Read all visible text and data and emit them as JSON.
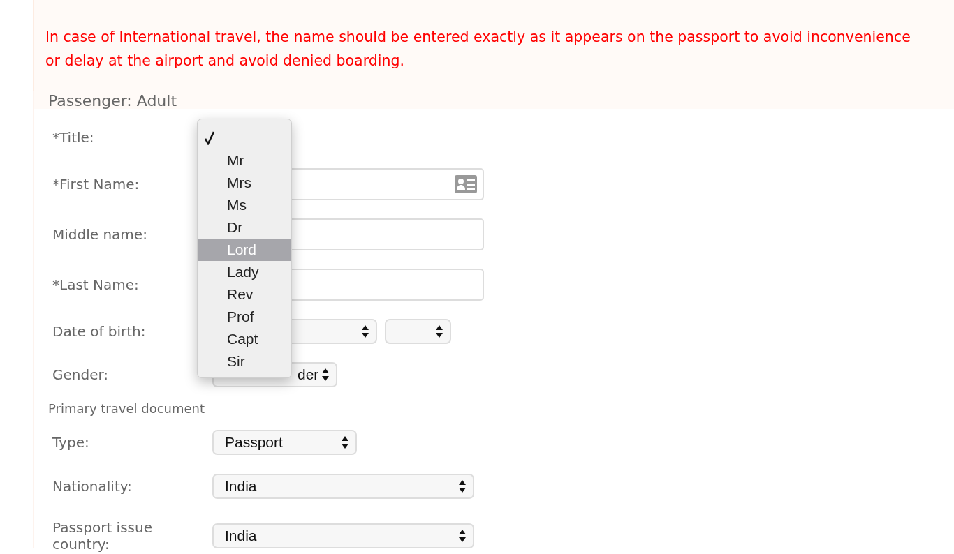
{
  "notice": "In case of International travel, the name should be entered exactly as it appears on the passport to avoid inconvenience or delay at the airport and avoid denied boarding.",
  "passenger_heading": "Passenger: Adult",
  "fields": [
    {
      "kind": "title",
      "label": "*Title:"
    },
    {
      "kind": "text",
      "label": "*First Name:",
      "card_icon": true
    },
    {
      "kind": "text",
      "label": "Middle name:"
    },
    {
      "kind": "text",
      "label": "*Last Name:"
    },
    {
      "kind": "date",
      "label": "Date of birth:"
    },
    {
      "kind": "select",
      "label": "Gender:",
      "value": "der"
    }
  ],
  "document_heading": "Primary travel document",
  "document_fields": [
    {
      "kind": "select",
      "label": "Type:",
      "value": "Passport"
    },
    {
      "kind": "select",
      "label": "Nationality:",
      "value": "India"
    },
    {
      "kind": "select",
      "label": "Passport issue country:",
      "value": "India"
    }
  ],
  "title_menu": {
    "blank_checked": true,
    "options": [
      {
        "label": "Mr",
        "highlighted": false
      },
      {
        "label": "Mrs",
        "highlighted": false
      },
      {
        "label": "Ms",
        "highlighted": false
      },
      {
        "label": "Dr",
        "highlighted": false
      },
      {
        "label": "Lord",
        "highlighted": true
      },
      {
        "label": "Lady",
        "highlighted": false
      },
      {
        "label": "Rev",
        "highlighted": false
      },
      {
        "label": "Prof",
        "highlighted": false
      },
      {
        "label": "Capt",
        "highlighted": false
      },
      {
        "label": "Sir",
        "highlighted": false
      }
    ]
  }
}
